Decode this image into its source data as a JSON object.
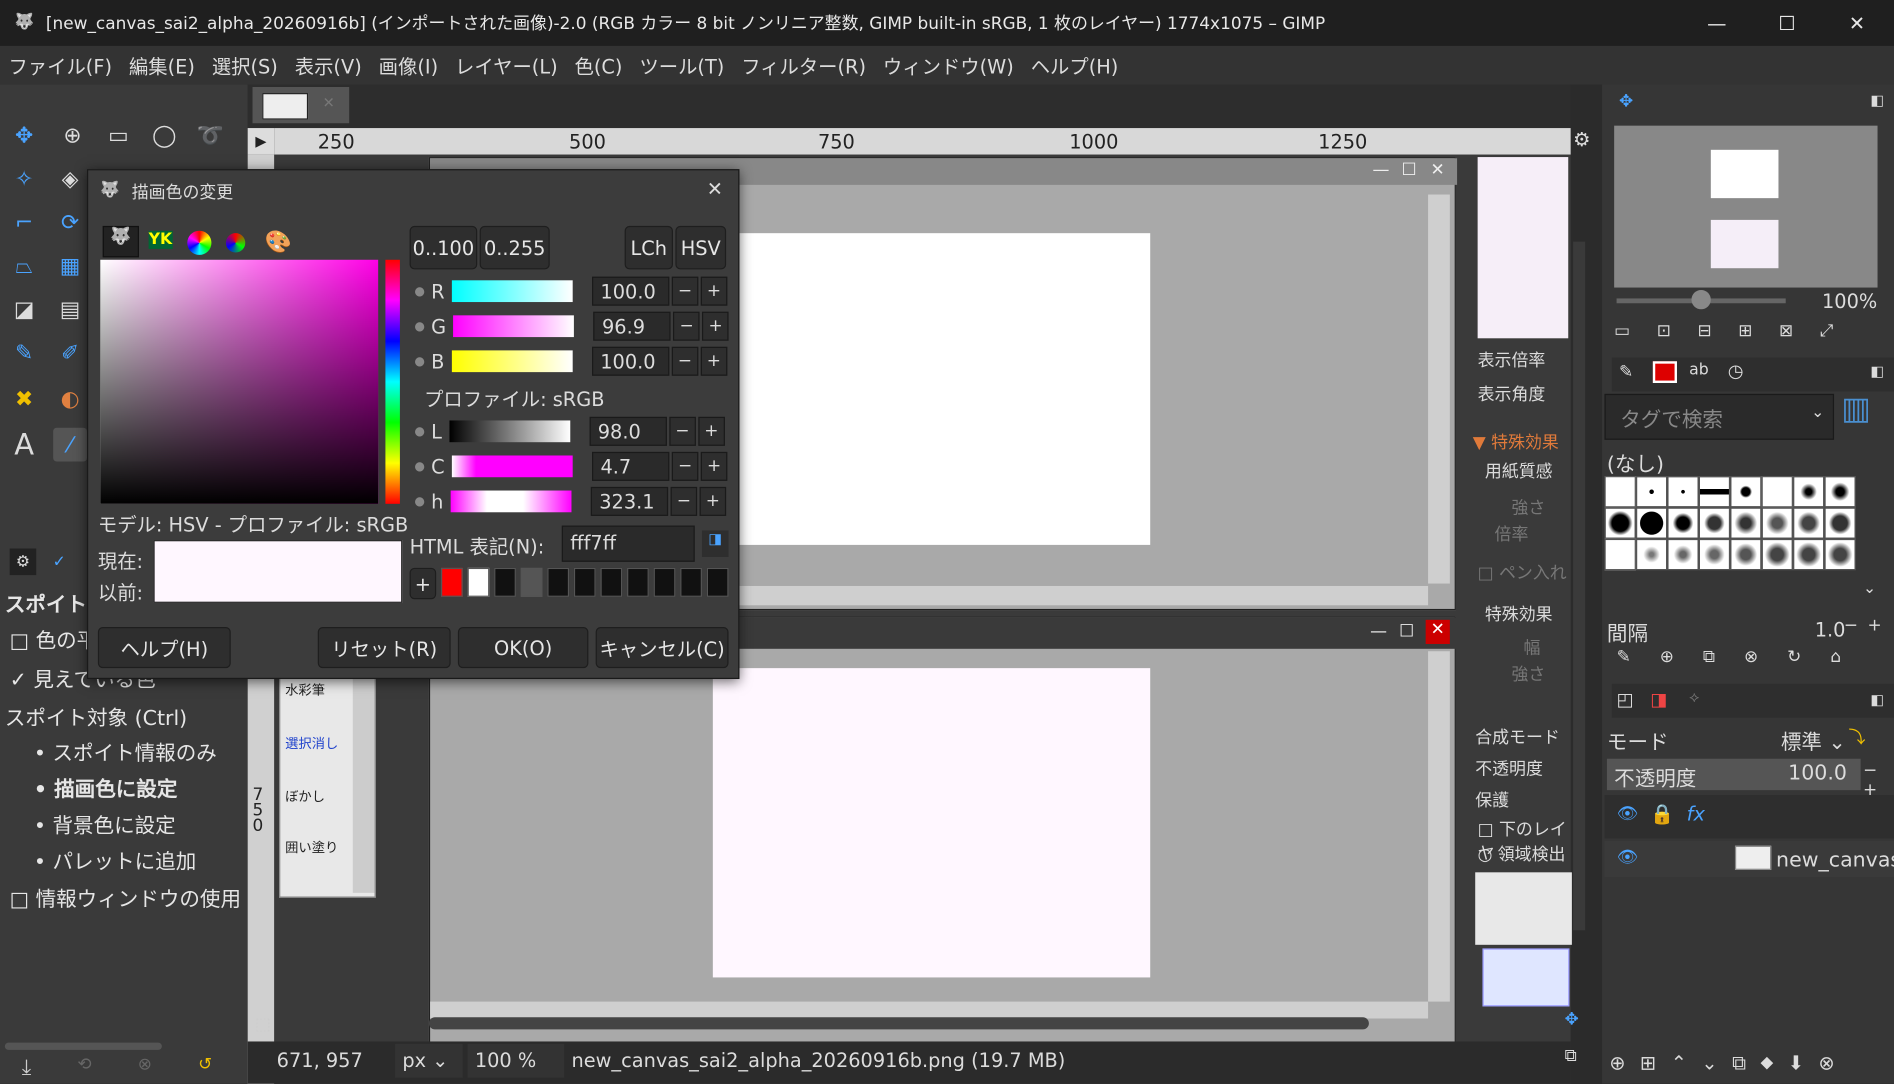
{
  "window": {
    "title": "[new_canvas_sai2_alpha_20260916b] (インポートされた画像)-2.0 (RGB カラー 8 bit ノンリニア整数, GIMP built-in sRGB, 1 枚のレイヤー) 1774x1075 – GIMP",
    "minimize": "—",
    "maximize": "☐",
    "close": "✕"
  },
  "menu": [
    "ファイル(F)",
    "編集(E)",
    "選択(S)",
    "表示(V)",
    "画像(I)",
    "レイヤー(L)",
    "色(C)",
    "ツール(T)",
    "フィルター(R)",
    "ウィンドウ(W)",
    "ヘルプ(H)"
  ],
  "ruler": {
    "ticks": [
      "250",
      "500",
      "750",
      "1000",
      "1250"
    ],
    "left_ticks": [
      "7",
      "5",
      "0"
    ]
  },
  "toolbox": {
    "section": "スポイト",
    "opt1": "色の平",
    "opt2": "見えている色",
    "target_label": "スポイト対象 (Ctrl)",
    "radio1": "スポイト情報のみ",
    "radio2": "描画色に設定",
    "radio3": "背景色に設定",
    "radio4": "パレットに追加",
    "info_window": "情報ウィンドウの使用 (S"
  },
  "dialog": {
    "title": "描画色の変更",
    "close": "✕",
    "range1": "0..100",
    "range2": "0..255",
    "lch": "LCh",
    "hsv": "HSV",
    "R": {
      "label": "R",
      "value": "100.0"
    },
    "G": {
      "label": "G",
      "value": "96.9"
    },
    "B": {
      "label": "B",
      "value": "100.0"
    },
    "profile": "プロファイル: sRGB",
    "L": {
      "label": "L",
      "value": "98.0"
    },
    "C": {
      "label": "C",
      "value": "4.7"
    },
    "h": {
      "label": "h",
      "value": "323.1"
    },
    "model": "モデル: HSV - プロファイル: sRGB",
    "current": "現在:",
    "previous": "以前:",
    "html_label": "HTML 表記(N):",
    "html_value": "fff7ff",
    "plus": "+",
    "help": "ヘルプ(H)",
    "reset": "リセット(R)",
    "ok": "OK(O)",
    "cancel": "キャンセル(C)",
    "minus_sym": "−",
    "plus_sym": "+"
  },
  "brushdock": {
    "mini": [
      "水彩筆",
      "選択消し",
      "ぼかし",
      "囲い塗り"
    ]
  },
  "midpanel": {
    "zoom": "表示倍率",
    "angle": "表示角度",
    "effects": "特殊効果",
    "paper": "用紙質感",
    "strength": "強さ",
    "scale": "倍率",
    "pen": "ペン入れ",
    "effects2": "特殊効果",
    "width": "幅",
    "strength2": "強さ",
    "blend": "合成モード",
    "opacity": "不透明度",
    "protect": "保護",
    "lower": "下のレイヤ",
    "region": "領域検出"
  },
  "right": {
    "zoom": "100%",
    "search_placeholder": "タグで検索",
    "none": "(なし)",
    "spacing_label": "間隔",
    "spacing_value": "1.0",
    "mode_label": "モード",
    "mode_value": "標準",
    "opacity_label": "不透明度",
    "opacity_value": "100.0",
    "layer_name": "new_canvas"
  },
  "status": {
    "coords": "671, 957",
    "unit": "px",
    "zoom": "100 %",
    "file": "new_canvas_sai2_alpha_20260916b.png (19.7 MB)"
  },
  "colors": {
    "current": "#fff7ff",
    "accent_red": "#ff0000"
  }
}
